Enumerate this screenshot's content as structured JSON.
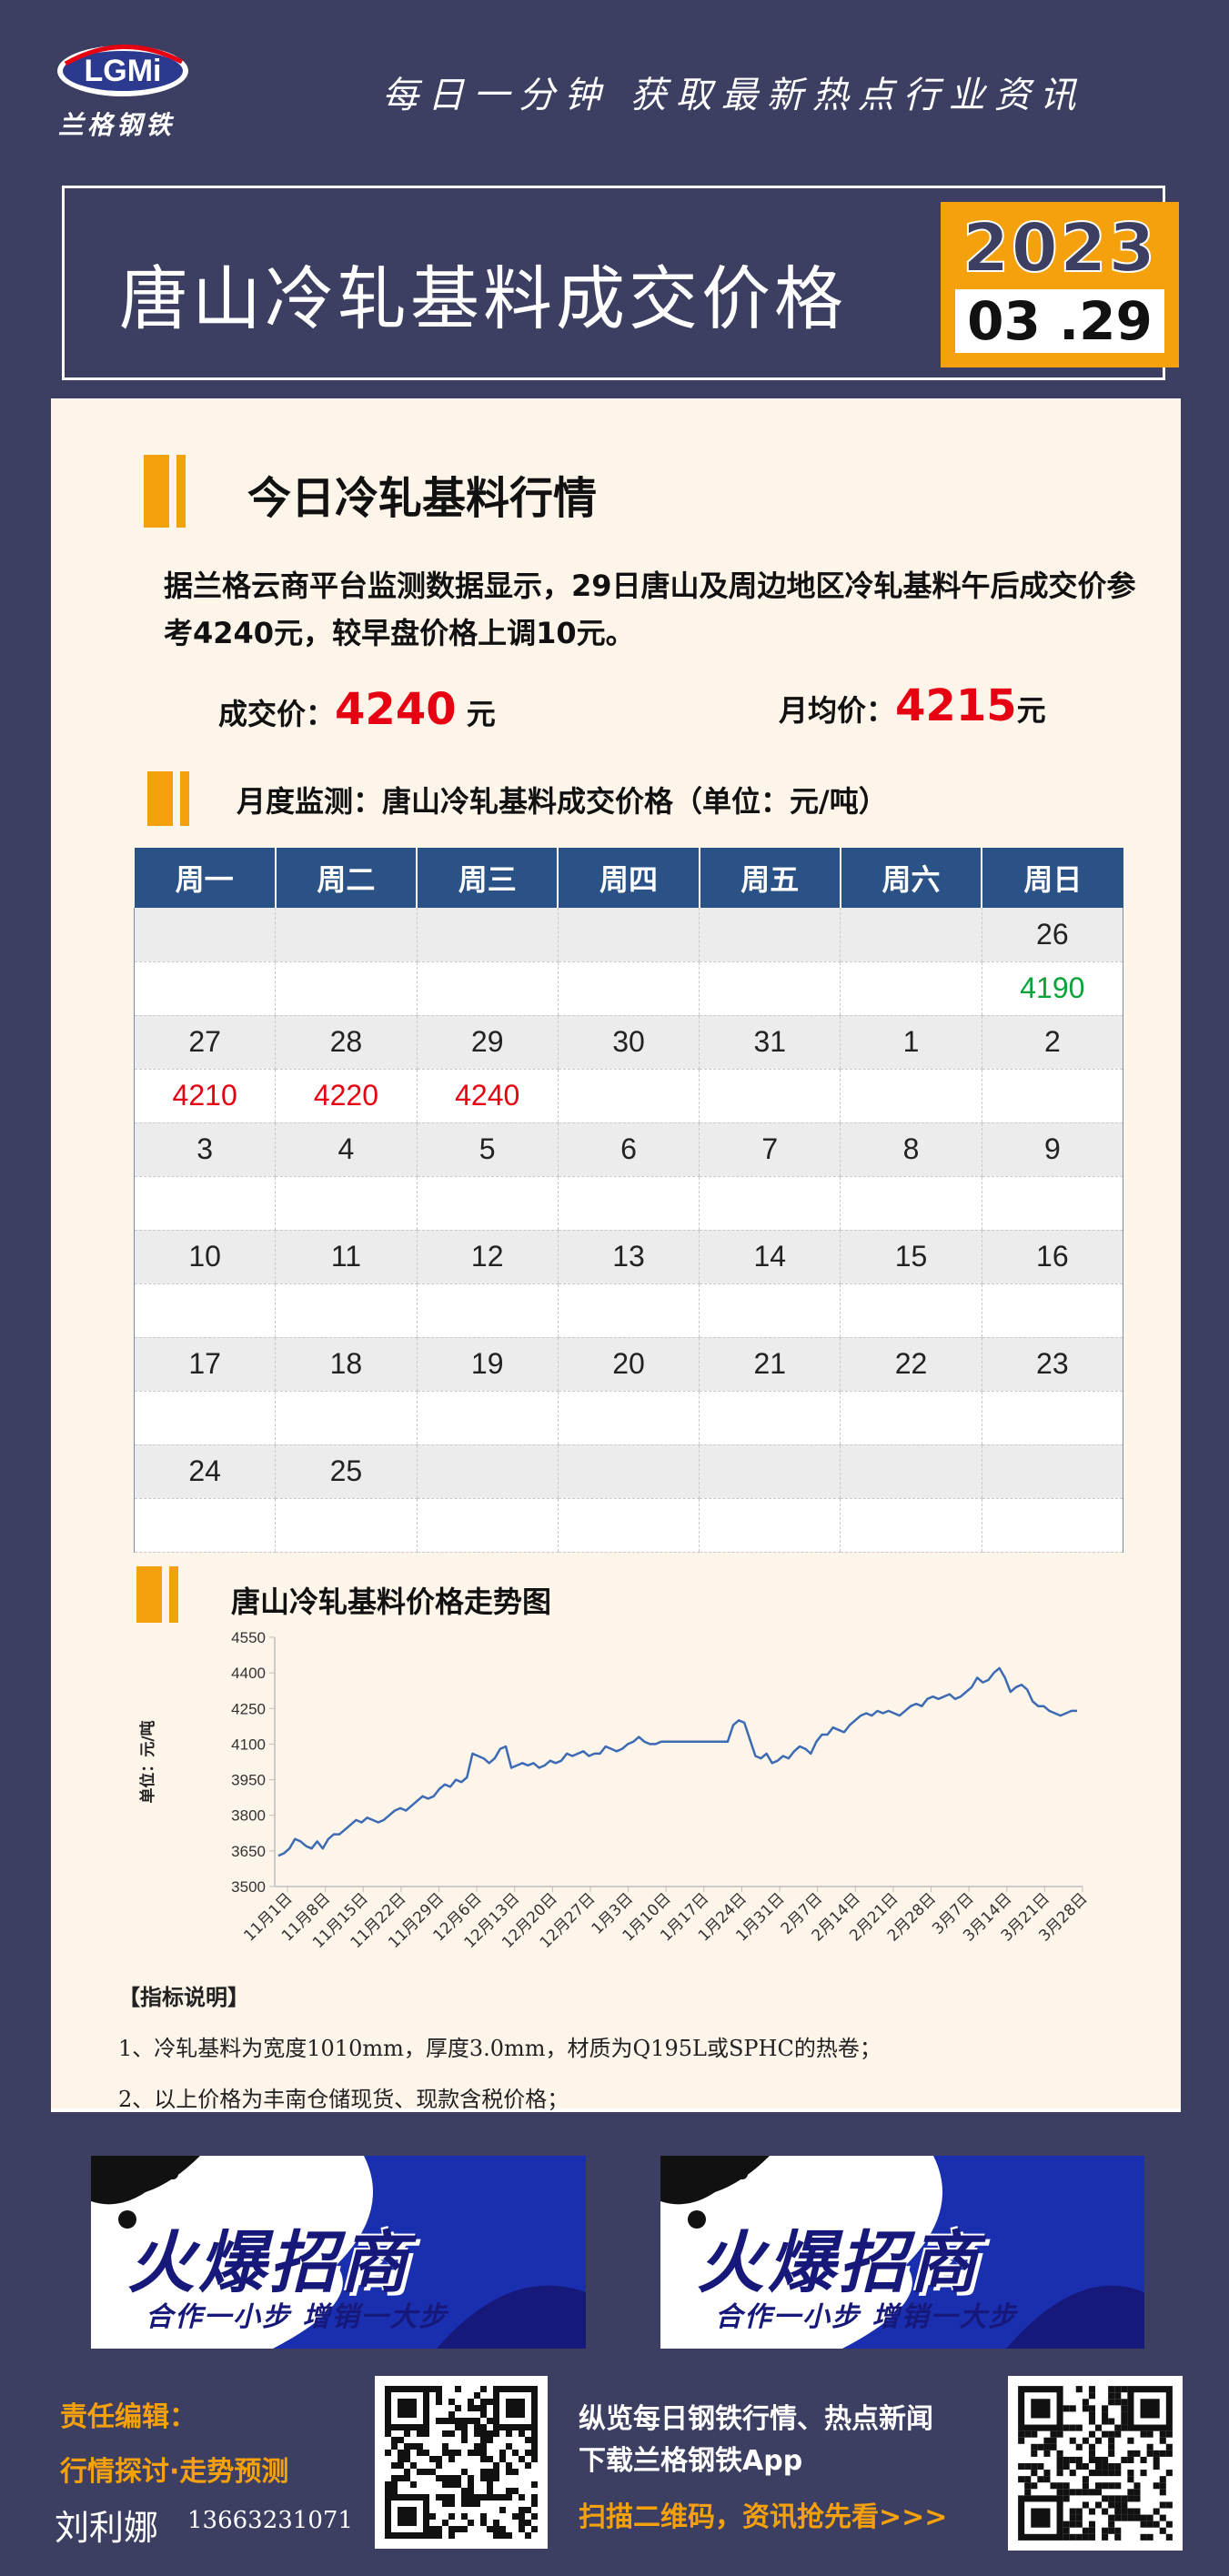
{
  "brand": {
    "logo_text": "LGMi",
    "name_cn": "兰格钢铁",
    "slogan": "每日一分钟  获取最新热点行业资讯"
  },
  "header": {
    "title": "唐山冷轧基料成交价格",
    "year": "2023",
    "date": "03 .29"
  },
  "today": {
    "heading": "今日冷轧基料行情",
    "intro": "据兰格云商平台监测数据显示，29日唐山及周边地区冷轧基料午后成交价参考4240元，较早盘价格上调10元。",
    "deal_label": "成交价：",
    "deal_value": "4240",
    "deal_unit": "元",
    "avg_label": "月均价：",
    "avg_value": "4215",
    "avg_unit": "元"
  },
  "monthly": {
    "heading": "月度监测：唐山冷轧基料成交价格（单位：元/吨）",
    "weekdays": [
      "周一",
      "周二",
      "周三",
      "周四",
      "周五",
      "周六",
      "周日"
    ],
    "weeks": [
      {
        "days": [
          "",
          "",
          "",
          "",
          "",
          "",
          "26"
        ],
        "values": [
          "",
          "",
          "",
          "",
          "",
          "",
          "4190"
        ]
      },
      {
        "days": [
          "27",
          "28",
          "29",
          "30",
          "31",
          "1",
          "2"
        ],
        "values": [
          "4210",
          "4220",
          "4240",
          "",
          "",
          "",
          ""
        ]
      },
      {
        "days": [
          "3",
          "4",
          "5",
          "6",
          "7",
          "8",
          "9"
        ],
        "values": [
          "",
          "",
          "",
          "",
          "",
          "",
          ""
        ]
      },
      {
        "days": [
          "10",
          "11",
          "12",
          "13",
          "14",
          "15",
          "16"
        ],
        "values": [
          "",
          "",
          "",
          "",
          "",
          "",
          ""
        ]
      },
      {
        "days": [
          "17",
          "18",
          "19",
          "20",
          "21",
          "22",
          "23"
        ],
        "values": [
          "",
          "",
          "",
          "",
          "",
          "",
          ""
        ]
      },
      {
        "days": [
          "24",
          "25",
          "",
          "",
          "",
          "",
          ""
        ],
        "values": [
          "",
          "",
          "",
          "",
          "",
          "",
          ""
        ]
      }
    ],
    "colors": {
      "up": "#e60012",
      "down": "#0aa33a"
    }
  },
  "trend": {
    "heading": "唐山冷轧基料价格走势图"
  },
  "chart_data": {
    "type": "line",
    "title": "",
    "xlabel": "",
    "ylabel": "单位：元/吨",
    "ylim": [
      3500,
      4550
    ],
    "yticks": [
      3500,
      3650,
      3800,
      3950,
      4100,
      4250,
      4400,
      4550
    ],
    "grid": false,
    "xtick_labels": [
      "11月1日",
      "11月8日",
      "11月15日",
      "11月22日",
      "11月29日",
      "12月6日",
      "12月13日",
      "12月20日",
      "12月27日",
      "1月3日",
      "1月10日",
      "1月17日",
      "1月24日",
      "1月31日",
      "2月7日",
      "2月14日",
      "2月21日",
      "2月28日",
      "3月7日",
      "3月14日",
      "3月21日",
      "3月28日"
    ],
    "line_color": "#3d6bb3",
    "series": [
      {
        "values": [
          3630,
          3640,
          3660,
          3700,
          3690,
          3670,
          3660,
          3690,
          3660,
          3700,
          3720,
          3720,
          3740,
          3760,
          3780,
          3770,
          3790,
          3780,
          3770,
          3780,
          3800,
          3820,
          3830,
          3820,
          3840,
          3860,
          3880,
          3870,
          3880,
          3910,
          3930,
          3920,
          3950,
          3940,
          3960,
          4060,
          4050,
          4040,
          4020,
          4040,
          4080,
          4090,
          4000,
          4010,
          4020,
          4010,
          4020,
          4000,
          4010,
          4030,
          4020,
          4030,
          4060,
          4050,
          4060,
          4070,
          4050,
          4060,
          4060,
          4090,
          4080,
          4070,
          4080,
          4100,
          4110,
          4130,
          4110,
          4100,
          4100,
          4110,
          4110,
          4110,
          4110,
          4110,
          4110,
          4110,
          4110,
          4110,
          4110,
          4110,
          4110,
          4110,
          4180,
          4200,
          4190,
          4120,
          4050,
          4040,
          4060,
          4020,
          4030,
          4050,
          4040,
          4070,
          4090,
          4080,
          4060,
          4110,
          4140,
          4140,
          4170,
          4160,
          4150,
          4180,
          4200,
          4220,
          4230,
          4220,
          4240,
          4230,
          4240,
          4230,
          4220,
          4240,
          4260,
          4270,
          4260,
          4290,
          4300,
          4290,
          4300,
          4310,
          4290,
          4300,
          4320,
          4340,
          4380,
          4360,
          4370,
          4400,
          4420,
          4380,
          4320,
          4340,
          4350,
          4330,
          4280,
          4260,
          4260,
          4240,
          4230,
          4220,
          4230,
          4240,
          4240
        ]
      }
    ]
  },
  "notes": {
    "heading": "【指标说明】",
    "items": [
      "1、冷轧基料为宽度1010mm，厚度3.0mm，材质为Q195L或SPHC的热卷；",
      "2、以上价格为丰南仓储现货、现款含税价格；"
    ]
  },
  "ads": [
    {
      "title": "火爆招商",
      "subtitle": "合作一小步  增销一大步"
    },
    {
      "title": "火爆招商",
      "subtitle": "合作一小步  增销一大步"
    }
  ],
  "footer": {
    "editor_label": "责任编辑：",
    "topic": "行情探讨·走势预测",
    "name": "刘利娜",
    "phone": "13663231071",
    "promo1": "纵览每日钢铁行情、热点新闻",
    "promo2": "下载兰格钢铁App",
    "promo3": "扫描二维码，资讯抢先看>>>"
  }
}
